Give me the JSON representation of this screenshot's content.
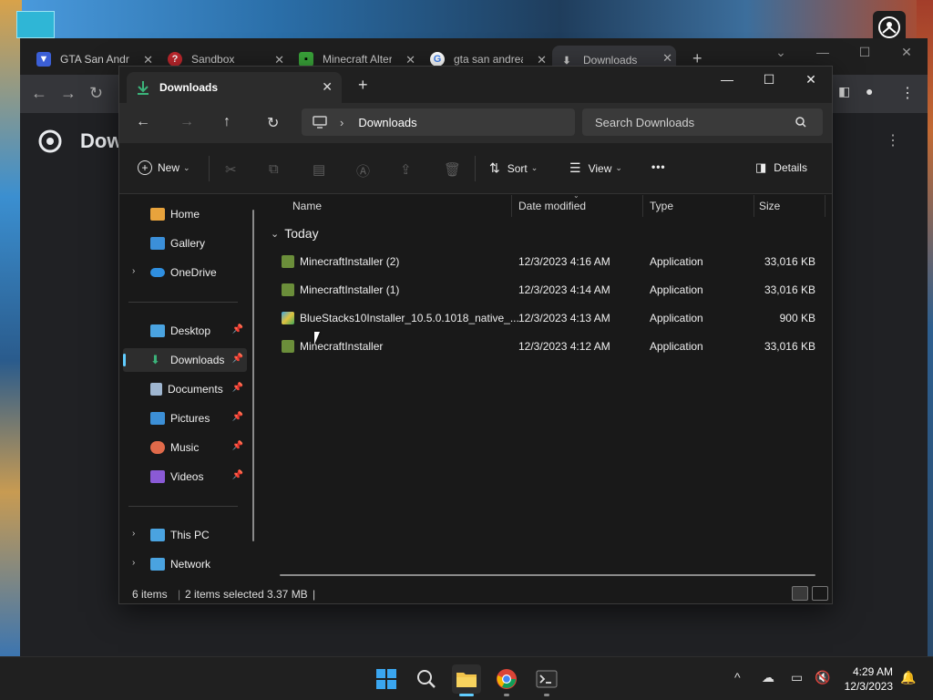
{
  "chrome": {
    "tabs": [
      {
        "label": "GTA San Andre",
        "icon": "shield-icon",
        "color": "#3b5fd6"
      },
      {
        "label": "Sandbox",
        "icon": "question-icon",
        "color": "#c0272d"
      },
      {
        "label": "Minecraft Alter",
        "icon": "creeper-icon",
        "color": "#3aa53a"
      },
      {
        "label": "gta san andrea",
        "icon": "google-icon",
        "color": "#4285f4"
      },
      {
        "label": "Downloads",
        "icon": "download-icon",
        "color": "#cccccc"
      }
    ],
    "page_title": "Dow"
  },
  "explorer": {
    "tab_title": "Downloads",
    "breadcrumb": "Downloads",
    "search_placeholder": "Search Downloads",
    "commands": {
      "new": "New",
      "sort": "Sort",
      "view": "View",
      "more": "•••",
      "details": "Details"
    },
    "nav": {
      "quick": [
        {
          "label": "Home",
          "color": "#e8a33c"
        },
        {
          "label": "Gallery",
          "color": "#3b8fd9"
        },
        {
          "label": "OneDrive",
          "color": "#2f8fe0"
        }
      ],
      "pinned": [
        {
          "label": "Desktop",
          "color": "#4aa3e0"
        },
        {
          "label": "Downloads",
          "color": "#3bb37a"
        },
        {
          "label": "Documents",
          "color": "#9fb6d0"
        },
        {
          "label": "Pictures",
          "color": "#3c8fd6"
        },
        {
          "label": "Music",
          "color": "#e06a4a"
        },
        {
          "label": "Videos",
          "color": "#8a5ad6"
        }
      ],
      "drives": [
        {
          "label": "This PC",
          "color": "#4aa3e0"
        },
        {
          "label": "Network",
          "color": "#4aa3e0"
        }
      ]
    },
    "columns": {
      "name": "Name",
      "date": "Date modified",
      "type": "Type",
      "size": "Size"
    },
    "group": "Today",
    "files": [
      {
        "name": "MinecraftInstaller (2)",
        "date": "12/3/2023 4:16 AM",
        "type": "Application",
        "size": "33,016 KB",
        "icon_color": "#6b8e3a"
      },
      {
        "name": "MinecraftInstaller (1)",
        "date": "12/3/2023 4:14 AM",
        "type": "Application",
        "size": "33,016 KB",
        "icon_color": "#6b8e3a"
      },
      {
        "name": "BlueStacks10Installer_10.5.0.1018_native_...",
        "date": "12/3/2023 4:13 AM",
        "type": "Application",
        "size": "900 KB",
        "icon_color": "#3fa7e0"
      },
      {
        "name": "MinecraftInstaller",
        "date": "12/3/2023 4:12 AM",
        "type": "Application",
        "size": "33,016 KB",
        "icon_color": "#6b8e3a"
      }
    ],
    "status": {
      "items": "6 items",
      "selected": "2 items selected",
      "size": "3.37 MB"
    }
  },
  "taskbar": {
    "time": "4:29 AM",
    "date": "12/3/2023"
  }
}
